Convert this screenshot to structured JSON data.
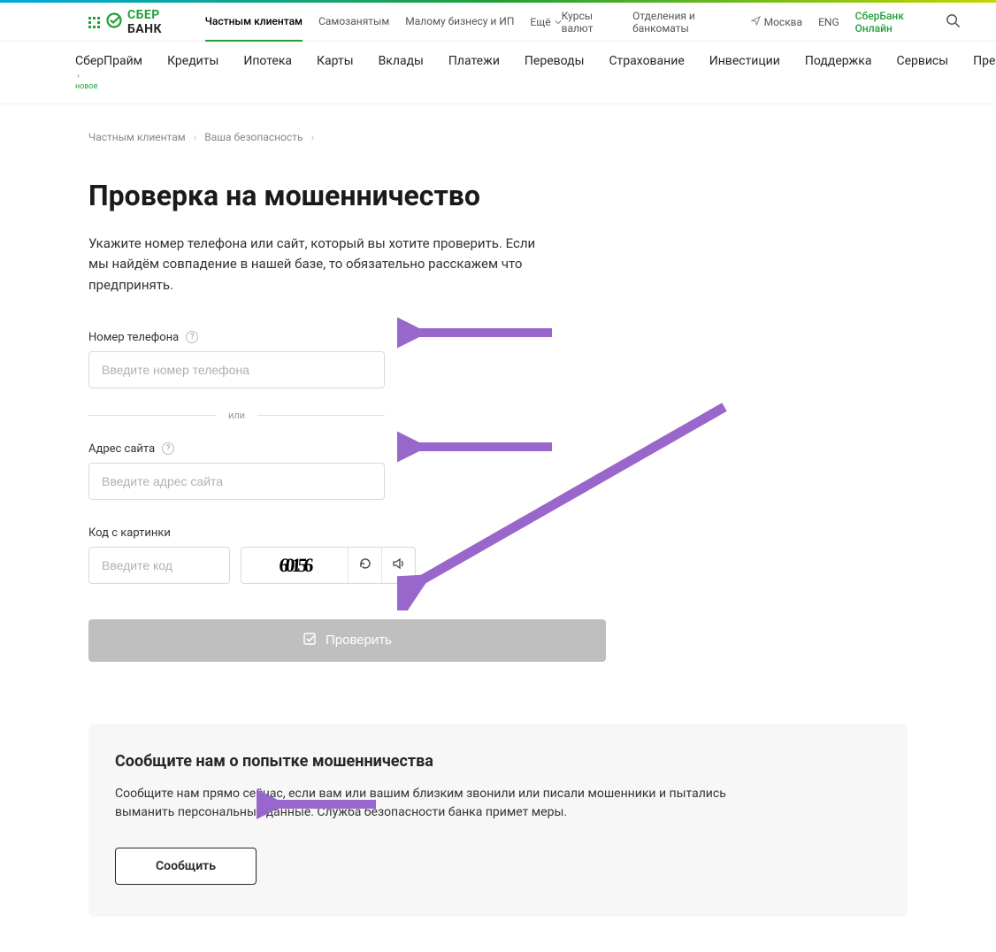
{
  "brand": {
    "name_green": "СБЕР",
    "name_black": "БАНК"
  },
  "top_segments": {
    "items": [
      "Частным клиентам",
      "Самозанятым",
      "Малому бизнесу и ИП"
    ],
    "more": "Ещё"
  },
  "utility": {
    "rates": "Курсы валют",
    "branches": "Отделения и банкоматы",
    "city": "Москва",
    "lang": "ENG",
    "online": "СберБанк Онлайн"
  },
  "main_nav": {
    "prime": "СберПрайм",
    "prime_badge": "новое",
    "items": [
      "Кредиты",
      "Ипотека",
      "Карты",
      "Вклады",
      "Платежи",
      "Переводы",
      "Страхование",
      "Инвестиции",
      "Поддержка",
      "Сервисы",
      "Премиум"
    ]
  },
  "breadcrumb": {
    "a": "Частным клиентам",
    "b": "Ваша безопасность"
  },
  "page": {
    "title": "Проверка на мошенничество",
    "lead": "Укажите номер телефона или сайт, который вы хотите проверить. Если мы найдём совпадение в нашей базе, то обязательно расскажем что предпринять."
  },
  "form": {
    "phone_label": "Номер телефона",
    "phone_placeholder": "Введите номер телефона",
    "or": "или",
    "site_label": "Адрес сайта",
    "site_placeholder": "Введите адрес сайта",
    "captcha_label": "Код с картинки",
    "captcha_placeholder": "Введите код",
    "captcha_value": "60156",
    "submit": "Проверить"
  },
  "report": {
    "title": "Сообщите нам о попытке мошенничества",
    "body": "Сообщите нам прямо сейчас, если вам или вашим близким звонили или писали мошенники и пытались выманить персональные данные. Служба безопасности банка примет меры.",
    "button": "Сообщить"
  }
}
